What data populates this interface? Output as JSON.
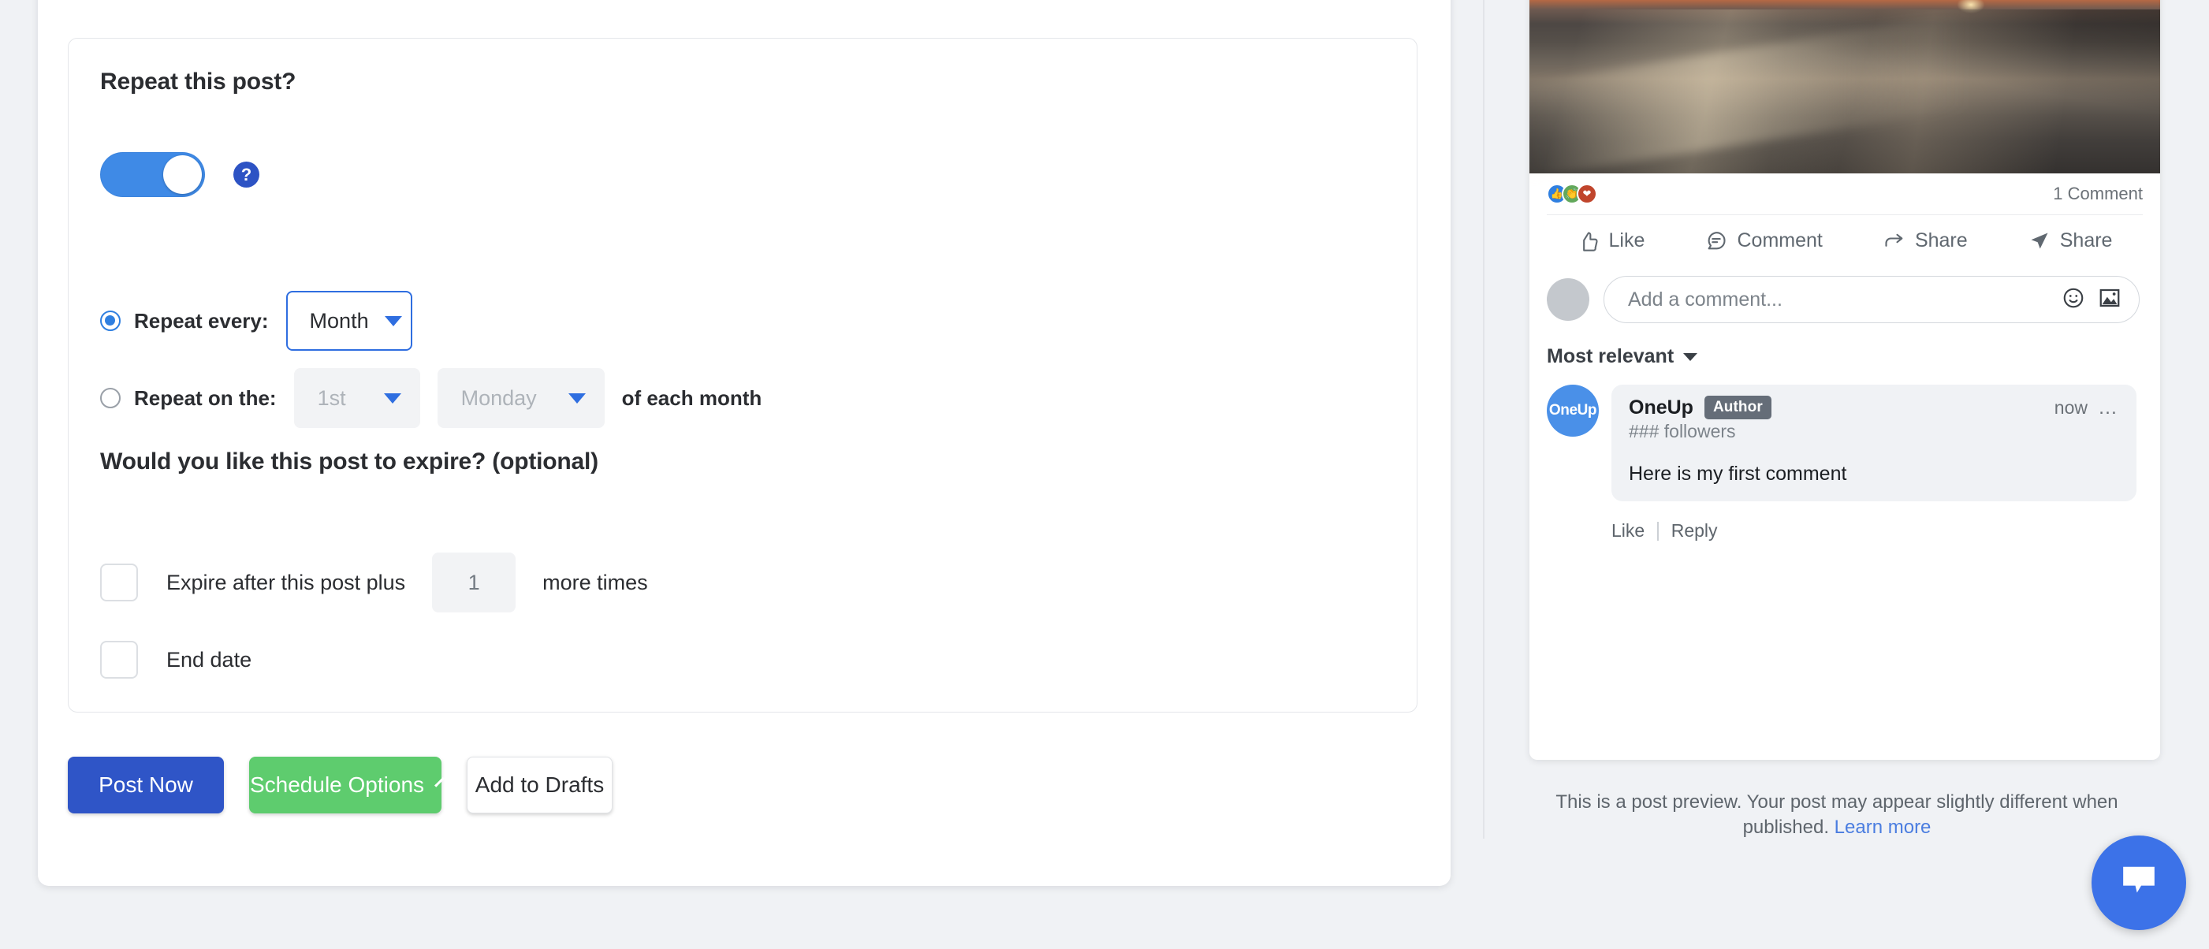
{
  "composer": {
    "repeat_section": {
      "title": "Repeat this post?",
      "toggle_on": true,
      "help_label": "?",
      "repeat_every": {
        "label": "Repeat every:",
        "selected": true,
        "value": "Month"
      },
      "repeat_on_the": {
        "label": "Repeat on the:",
        "selected": false,
        "ordinal_value": "1st",
        "weekday_value": "Monday",
        "trailing_text": "of each month"
      }
    },
    "expire_section": {
      "title": "Would you like this post to expire? (optional)",
      "expire_after": {
        "checked": false,
        "label": "Expire after this post plus",
        "count": "1",
        "suffix": "more times"
      },
      "end_date": {
        "checked": false,
        "label": "End date"
      }
    },
    "actions": {
      "post_now": "Post Now",
      "schedule_options": "Schedule Options",
      "add_to_drafts": "Add to Drafts"
    }
  },
  "preview": {
    "image_alt": "ocean-wave-at-sunset",
    "reactions": [
      "like-reaction-icon",
      "care-reaction-icon",
      "love-reaction-icon"
    ],
    "comment_count": "1 Comment",
    "action_bar": [
      {
        "label": "Like",
        "icon": "thumbs-up-icon"
      },
      {
        "label": "Comment",
        "icon": "speech-bubble-icon"
      },
      {
        "label": "Share",
        "icon": "arrow-share-icon"
      },
      {
        "label": "Share",
        "icon": "send-plane-icon"
      }
    ],
    "comment_input": {
      "placeholder": "Add a comment...",
      "emoji_icon": "emoji-smiley-icon",
      "image_icon": "image-attach-icon"
    },
    "sort": "Most relevant",
    "comment": {
      "avatar_text": "OneUp",
      "author": "OneUp",
      "author_badge": "Author",
      "time": "now",
      "followers": "### followers",
      "text": "Here is my first comment",
      "like_label": "Like",
      "reply_label": "Reply"
    },
    "footer_note": "This is a post preview. Your post may appear slightly different when published.",
    "footer_link": "Learn more"
  },
  "chat_widget": {
    "icon": "chat-bubble-icon"
  },
  "colors": {
    "primary_blue": "#2f55c7",
    "toggle_blue": "#3f8ae6",
    "schedule_green": "#5ecc6e",
    "link_blue": "#4a7de0",
    "help_badge_blue": "#2d53c4"
  }
}
